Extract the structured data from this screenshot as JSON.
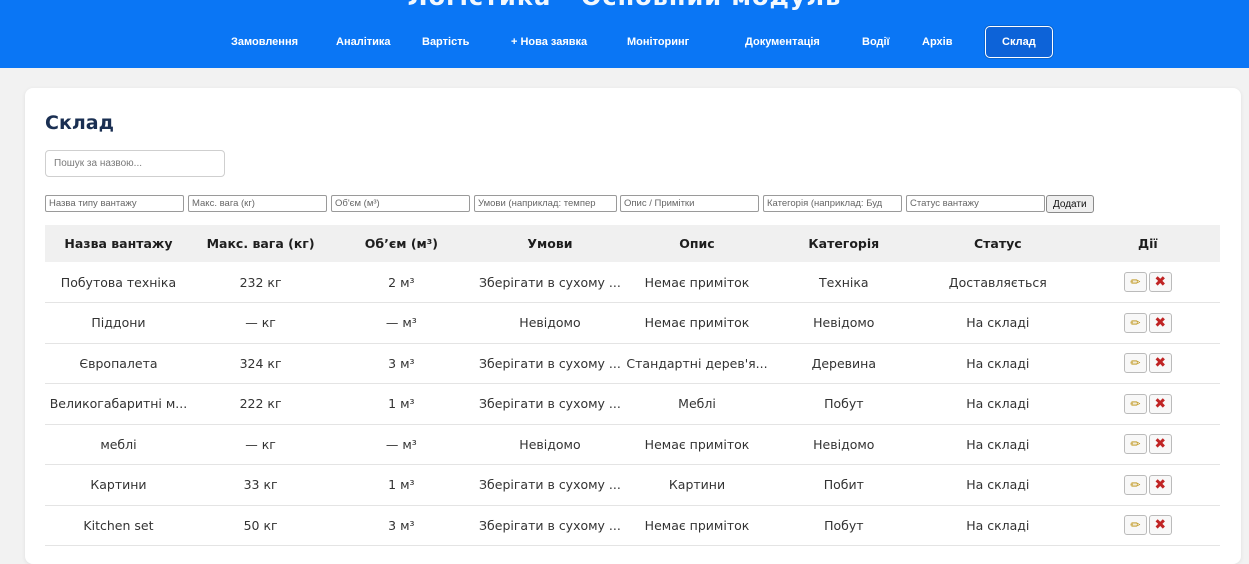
{
  "header": {
    "title": "Логістика - Основний модуль",
    "nav": [
      {
        "label": "Замовлення"
      },
      {
        "label": "Аналітика"
      },
      {
        "label": "Вартість"
      },
      {
        "label": "+ Нова заявка"
      },
      {
        "label": "Моніторинг"
      },
      {
        "label": "Документація"
      },
      {
        "label": "Водії"
      },
      {
        "label": "Архів"
      },
      {
        "label": "Склад",
        "active": true
      }
    ]
  },
  "page": {
    "title": "Склад",
    "search_placeholder": "Пошук за назвою..."
  },
  "form": {
    "name_placeholder": "Назва типу вантажу",
    "weight_placeholder": "Макс. вага (кг)",
    "volume_placeholder": "Об'єм (м³)",
    "conditions_placeholder": "Умови (наприклад: темпер",
    "notes_placeholder": "Опис / Примітки",
    "category_placeholder": "Категорія (наприклад: Буд",
    "status_placeholder": "Статус вантажу",
    "add_label": "Додати"
  },
  "table": {
    "headers": [
      "Назва вантажу",
      "Макс. вага (кг)",
      "Об’єм (м³)",
      "Умови",
      "Опис",
      "Категорія",
      "Статус",
      "Дії"
    ],
    "rows": [
      {
        "name": "Побутова техніка",
        "weight": "232 кг",
        "volume": "2 м³",
        "conditions": "Зберігати в сухому ...",
        "description": "Немає приміток",
        "category": "Техніка",
        "status": "Доставляється"
      },
      {
        "name": "Піддони",
        "weight": "— кг",
        "volume": "— м³",
        "conditions": "Невідомо",
        "description": "Немає приміток",
        "category": "Невідомо",
        "status": "На складі"
      },
      {
        "name": "Європалета",
        "weight": "324 кг",
        "volume": "3 м³",
        "conditions": "Зберігати в сухому ...",
        "description": "Стандартні дерев'я...",
        "category": "Деревина",
        "status": "На складі"
      },
      {
        "name": "Великогабаритні м...",
        "weight": "222 кг",
        "volume": "1 м³",
        "conditions": "Зберігати в сухому ...",
        "description": "Меблі",
        "category": "Побут",
        "status": "На складі"
      },
      {
        "name": "меблі",
        "weight": "— кг",
        "volume": "— м³",
        "conditions": "Невідомо",
        "description": "Немає приміток",
        "category": "Невідомо",
        "status": "На складі"
      },
      {
        "name": "Картини",
        "weight": "33 кг",
        "volume": "1 м³",
        "conditions": "Зберігати в сухому ...",
        "description": "Картини",
        "category": "Побит",
        "status": "На складі"
      },
      {
        "name": "Kitchen set",
        "weight": "50 кг",
        "volume": "3 м³",
        "conditions": "Зберігати в сухому ...",
        "description": "Немає приміток",
        "category": "Побут",
        "status": "На складі"
      }
    ]
  },
  "colors": {
    "header_bg": "#0a76f5",
    "active_tab_bg": "#0d63d8",
    "title_color": "#1a2f52",
    "edit_icon": "#b88a00",
    "delete_icon": "#c02424"
  },
  "icons": {
    "edit": "pencil-icon",
    "delete": "cross-icon"
  }
}
